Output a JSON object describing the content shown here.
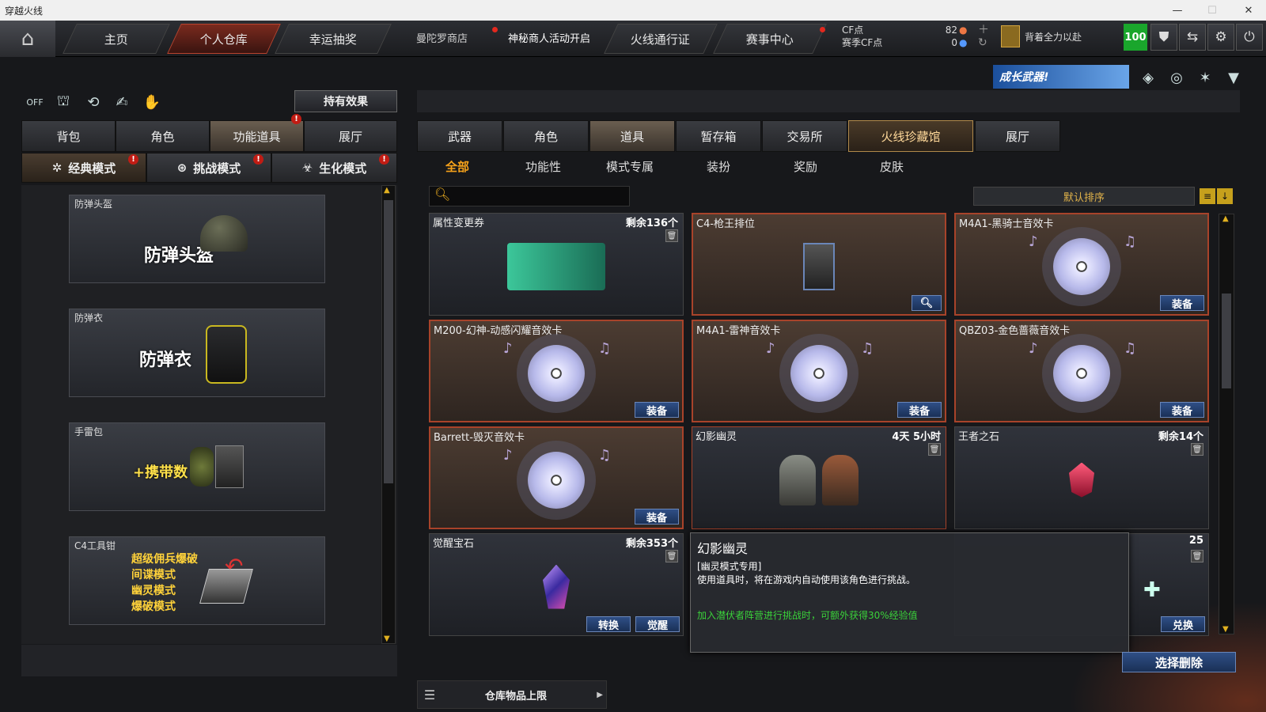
{
  "window": {
    "title": "穿越火线",
    "minimize": "—",
    "maximize": "☐",
    "close": "✕"
  },
  "topnav": {
    "home_icon": "home-icon",
    "tabs": [
      {
        "label": "主页"
      },
      {
        "label": "个人仓库"
      },
      {
        "label": "幸运抽奖"
      }
    ],
    "links": [
      {
        "label": "曼陀罗商店"
      },
      {
        "label": "神秘商人活动开启"
      },
      {
        "label": "火线通行证"
      },
      {
        "label": "赛事中心"
      }
    ],
    "currency": {
      "cf_label": "CF点",
      "cf_value": "82",
      "season_label": "赛季CF点",
      "season_value": "0"
    },
    "player_name": "背着全力以赴",
    "level": "100"
  },
  "banner": {
    "text": "成长武器!"
  },
  "left": {
    "effect_button": "持有效果",
    "tabs": [
      {
        "label": "背包"
      },
      {
        "label": "角色"
      },
      {
        "label": "功能道具"
      },
      {
        "label": "展厅"
      }
    ],
    "modes": [
      {
        "label": "经典模式"
      },
      {
        "label": "挑战模式"
      },
      {
        "label": "生化模式"
      }
    ],
    "slots": [
      {
        "label": "防弹头盔",
        "art_text": "防弹头盔"
      },
      {
        "label": "防弹衣",
        "art_text": "防弹衣"
      },
      {
        "label": "手雷包",
        "art_text": "+携带数"
      },
      {
        "label": "C4工具钳",
        "art_lines": [
          "超级佣兵爆破",
          "间谍模式",
          "幽灵模式",
          "爆破模式"
        ]
      }
    ]
  },
  "right": {
    "tabs": [
      {
        "label": "武器"
      },
      {
        "label": "角色"
      },
      {
        "label": "道具"
      },
      {
        "label": "暂存箱"
      },
      {
        "label": "交易所"
      },
      {
        "label": "火线珍藏馆"
      },
      {
        "label": "展厅"
      }
    ],
    "subtabs": [
      {
        "label": "全部"
      },
      {
        "label": "功能性"
      },
      {
        "label": "模式专属"
      },
      {
        "label": "装扮"
      },
      {
        "label": "奖励"
      },
      {
        "label": "皮肤"
      }
    ],
    "search_placeholder": "",
    "sort_label": "默认排序",
    "items": [
      {
        "name": "属性变更券",
        "qty": "剩余136个"
      },
      {
        "name": "C4-枪王排位",
        "qty": ""
      },
      {
        "name": "M4A1-黑骑士音效卡",
        "qty": "",
        "button": "装备"
      },
      {
        "name": "M200-幻神-动感闪耀音效卡",
        "qty": "",
        "button": "装备"
      },
      {
        "name": "M4A1-雷神音效卡",
        "qty": "",
        "button": "装备"
      },
      {
        "name": "QBZ03-金色蔷薇音效卡",
        "qty": "",
        "button": "装备"
      },
      {
        "name": "Barrett-毁灭音效卡",
        "qty": "",
        "button": "装备"
      },
      {
        "name": "幻影幽灵",
        "qty": "4天 5小时"
      },
      {
        "name": "王者之石",
        "qty": "剩余14个"
      },
      {
        "name": "觉醒宝石",
        "qty": "剩余353个",
        "button": "转换",
        "button2": "觉醒"
      },
      {
        "name": "",
        "qty": "25",
        "button": "兑换"
      }
    ],
    "tooltip": {
      "title": "幻影幽灵",
      "line1": "[幽灵模式专用]",
      "line2": "使用道具时，将在游戏内自动使用该角色进行挑战。",
      "line3": "加入潜伏者阵营进行挑战时，可额外获得30%经验值"
    },
    "delete_button": "选择删除",
    "capacity_label": "仓库物品上限"
  }
}
